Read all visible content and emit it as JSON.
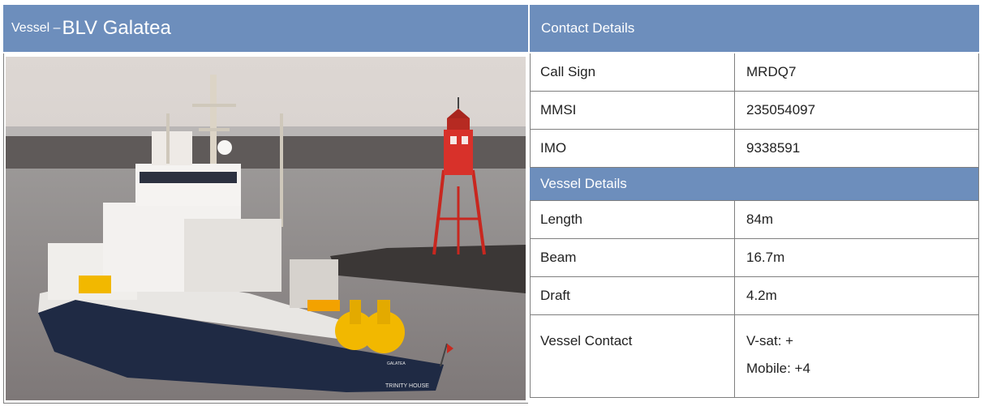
{
  "header": {
    "vessel_prefix": "Vessel –",
    "vessel_name": "BLV Galatea",
    "contact_title": "Contact Details"
  },
  "contact_details": [
    {
      "label": "Call Sign",
      "value": "MRDQ7"
    },
    {
      "label": "MMSI",
      "value": "235054097"
    },
    {
      "label": "IMO",
      "value": "9338591"
    }
  ],
  "vessel_section_title": "Vessel Details",
  "vessel_details": [
    {
      "label": "Length",
      "value": "84m"
    },
    {
      "label": "Beam",
      "value": "16.7m"
    },
    {
      "label": "Draft",
      "value": "4.2m"
    }
  ],
  "vessel_contact": {
    "label": "Vessel Contact",
    "vsat": "V-sat: +",
    "mobile": "Mobile: +4"
  },
  "photo": {
    "hull_text": "TRINITY HOUSE",
    "bow_name": "GALATEA"
  },
  "colors": {
    "header_bg": "#6d8ebc",
    "hull": "#1f2a44",
    "lighthouse": "#d8312a",
    "buoy": "#f2b800"
  }
}
